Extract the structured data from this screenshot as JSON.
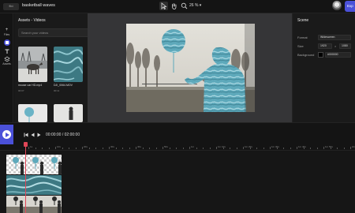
{
  "header": {
    "logo": "flixi",
    "project_title": "basketball waves",
    "zoom": "26 %",
    "export_label": "Exp"
  },
  "nav": {
    "items": [
      {
        "label": "Files",
        "icon": "plus-icon"
      },
      {
        "label": "",
        "icon": "assets-icon"
      },
      {
        "label": "",
        "icon": "text-icon"
      },
      {
        "label": "Assets",
        "icon": "layers-icon"
      }
    ]
  },
  "assets": {
    "title": "Assets - Videos",
    "search_placeholder": "Search your videos",
    "items": [
      {
        "name": "moose car HD.mp4",
        "duration": "00:07"
      },
      {
        "name": "DJI_0064.MOV",
        "duration": "00:11"
      },
      {
        "name": "",
        "duration": ""
      },
      {
        "name": "",
        "duration": ""
      }
    ]
  },
  "scene": {
    "title": "Scene",
    "format_label": "Format",
    "format_value": "Widescreen",
    "size_label": "Size",
    "width": "1920",
    "height": "1080",
    "background_label": "Background",
    "background_value": "#000000",
    "background_color": "#000000"
  },
  "transport": {
    "current": "00:00:00",
    "separator": "/",
    "total": "02:00:00"
  },
  "ruler": {
    "labels": [
      "1s",
      "10s",
      "20s",
      "30s",
      "40s",
      "50s",
      "1m",
      "1m 10s",
      "1m 20s",
      "1m 30s",
      "1m 40s",
      "1m 50s",
      "2m"
    ]
  },
  "colors": {
    "accent": "#4b51d9",
    "playhead": "#e04657",
    "cutout": "#6ab3c6"
  }
}
